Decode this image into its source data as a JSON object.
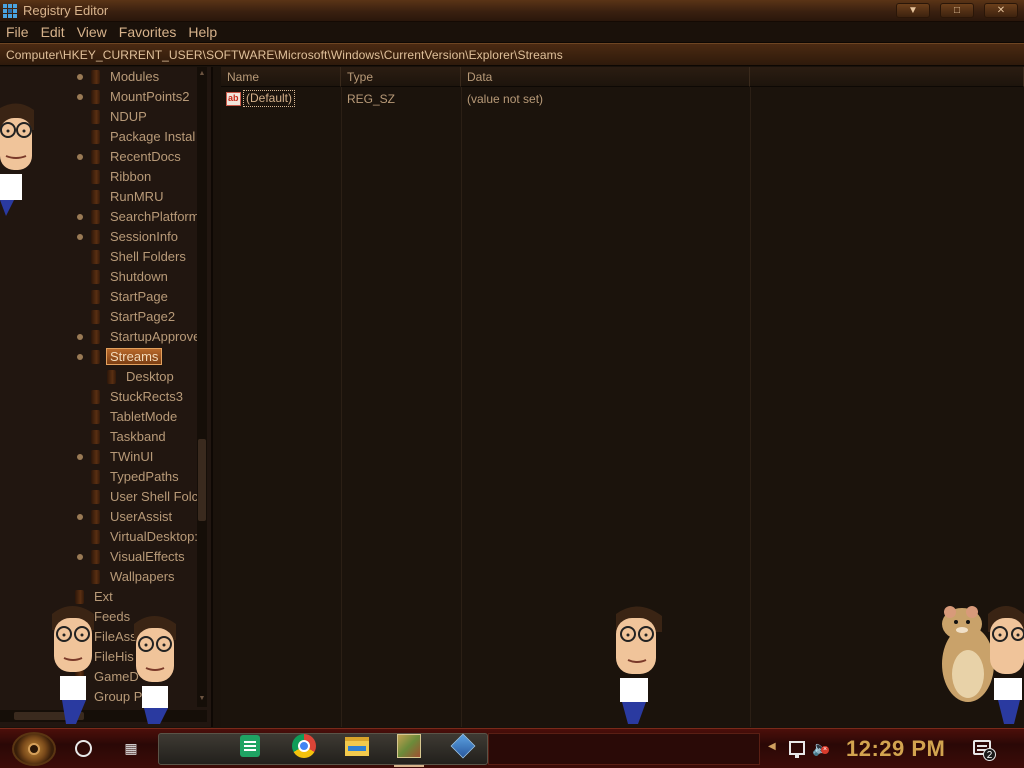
{
  "window": {
    "title": "Registry Editor",
    "buttons": [
      "min",
      "max",
      "close"
    ]
  },
  "menu": [
    "File",
    "Edit",
    "View",
    "Favorites",
    "Help"
  ],
  "address": "Computer\\HKEY_CURRENT_USER\\SOFTWARE\\Microsoft\\Windows\\CurrentVersion\\Explorer\\Streams",
  "tree": {
    "items": [
      {
        "label": "Modules",
        "expandable": true
      },
      {
        "label": "MountPoints2",
        "expandable": true
      },
      {
        "label": "NDUP",
        "expandable": false
      },
      {
        "label": "Package Instal",
        "expandable": false
      },
      {
        "label": "RecentDocs",
        "expandable": true
      },
      {
        "label": "Ribbon",
        "expandable": false
      },
      {
        "label": "RunMRU",
        "expandable": false
      },
      {
        "label": "SearchPlatform",
        "expandable": true
      },
      {
        "label": "SessionInfo",
        "expandable": true
      },
      {
        "label": "Shell Folders",
        "expandable": false
      },
      {
        "label": "Shutdown",
        "expandable": false
      },
      {
        "label": "StartPage",
        "expandable": false
      },
      {
        "label": "StartPage2",
        "expandable": false
      },
      {
        "label": "StartupApprove",
        "expandable": true
      },
      {
        "label": "Streams",
        "expandable": true,
        "selected": true
      },
      {
        "label": "Desktop",
        "expandable": false,
        "child": true
      },
      {
        "label": "StuckRects3",
        "expandable": false
      },
      {
        "label": "TabletMode",
        "expandable": false
      },
      {
        "label": "Taskband",
        "expandable": false
      },
      {
        "label": "TWinUI",
        "expandable": true
      },
      {
        "label": "TypedPaths",
        "expandable": false
      },
      {
        "label": "User Shell Folc",
        "expandable": false
      },
      {
        "label": "UserAssist",
        "expandable": true
      },
      {
        "label": "VirtualDesktop:",
        "expandable": false
      },
      {
        "label": "VisualEffects",
        "expandable": true
      },
      {
        "label": "Wallpapers",
        "expandable": false
      }
    ],
    "lower_items": [
      {
        "label": "Ext"
      },
      {
        "label": "Feeds"
      },
      {
        "label": "FileAss"
      },
      {
        "label": "FileHis"
      },
      {
        "label": "GameD"
      },
      {
        "label": "Group P"
      }
    ]
  },
  "values": {
    "columns": [
      "Name",
      "Type",
      "Data"
    ],
    "rows": [
      {
        "name": "(Default)",
        "type": "REG_SZ",
        "data": "(value not set)",
        "icon": "ab-string-icon"
      }
    ]
  },
  "taskbar": {
    "pinned_apps": [
      "sheets-icon",
      "chrome-icon",
      "file-explorer-icon",
      "paint-app-icon",
      "regedit-icon"
    ],
    "clock": "12:29 PM",
    "notification_count": "2"
  },
  "colors": {
    "accent": "#b8692b",
    "clock": "#d2a44f",
    "taskbar": "#2a0806"
  }
}
